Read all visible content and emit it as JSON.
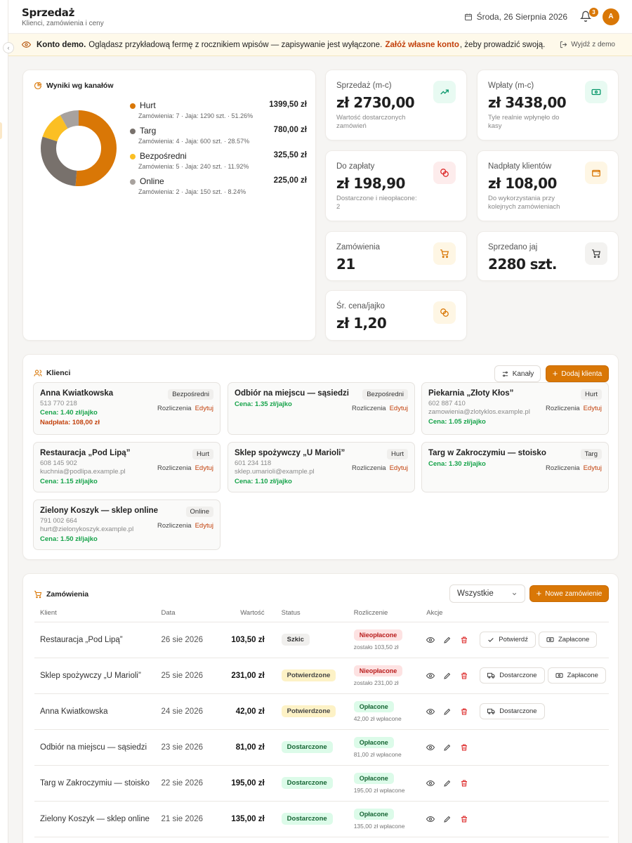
{
  "header": {
    "title": "Sprzedaż",
    "subtitle": "Klienci, zamówienia i ceny",
    "date": "Środa, 26 Sierpnia 2026",
    "notifications": "3",
    "avatar": "A"
  },
  "banner": {
    "bold": "Konto demo.",
    "text1": "Oglądasz przykładową fermę z rocznikiem wpisów — zapisywanie jest wyłączone.",
    "link": "Załóż własne konto",
    "text2": ", żeby prowadzić swoją.",
    "exit": "Wyjdź z demo"
  },
  "channels": {
    "title": "Wyniki wg kanałów",
    "items": [
      {
        "name": "Hurt",
        "value": "1399,50 zł",
        "meta": "Zamówienia: 7 · Jaja: 1290 szt. · 51.26%",
        "color": "#d97706"
      },
      {
        "name": "Targ",
        "value": "780,00 zł",
        "meta": "Zamówienia: 4 · Jaja: 600 szt. · 28.57%",
        "color": "#78716c"
      },
      {
        "name": "Bezpośredni",
        "value": "325,50 zł",
        "meta": "Zamówienia: 5 · Jaja: 240 szt. · 11.92%",
        "color": "#fbbf24"
      },
      {
        "name": "Online",
        "value": "225,00 zł",
        "meta": "Zamówienia: 2 · Jaja: 150 szt. · 8.24%",
        "color": "#a8a29e"
      }
    ]
  },
  "chart_data": {
    "type": "pie",
    "categories": [
      "Hurt",
      "Targ",
      "Bezpośredni",
      "Online"
    ],
    "values": [
      1399.5,
      780.0,
      325.5,
      225.0
    ],
    "percent": [
      51.26,
      28.57,
      11.92,
      8.24
    ],
    "title": "Wyniki wg kanałów"
  },
  "stats": [
    {
      "label": "Sprzedaż (m-c)",
      "value": "zł 2730,00",
      "desc": "Wartość dostarczonych zamówień",
      "icon": "trend-up-icon"
    },
    {
      "label": "Wpłaty (m-c)",
      "value": "zł 3438,00",
      "desc": "Tyle realnie wpłynęło do kasy",
      "icon": "cash-icon"
    },
    {
      "label": "Do zapłaty",
      "value": "zł 198,90",
      "desc": "Dostarczone i nieopłacone: 2",
      "icon": "coins-icon"
    },
    {
      "label": "Nadpłaty klientów",
      "value": "zł 108,00",
      "desc": "Do wykorzystania przy kolejnych zamówieniach",
      "icon": "wallet-icon"
    },
    {
      "label": "Zamówienia",
      "value": "21",
      "desc": "",
      "icon": "cart-icon"
    },
    {
      "label": "Sprzedano jaj",
      "value": "2280 szt.",
      "desc": "",
      "icon": "cart-icon"
    },
    {
      "label": "Śr. cena/jajko",
      "value": "zł 1,20",
      "desc": "",
      "icon": "coins-icon"
    }
  ],
  "customers": {
    "title": "Klienci",
    "channels_button": "Kanały",
    "add_button": "Dodaj klienta",
    "settlements": "Rozliczenia",
    "edit": "Edytuj",
    "items": [
      {
        "name": "Anna Kwiatkowska",
        "chip": "Bezpośredni",
        "phone": "513 770 218",
        "email": "",
        "price": "Cena: 1.40 zł/jajko",
        "overpay": "Nadpłata: 108,00 zł"
      },
      {
        "name": "Odbiór na miejscu — sąsiedzi",
        "chip": "Bezpośredni",
        "phone": "",
        "email": "",
        "price": "Cena: 1.35 zł/jajko",
        "overpay": ""
      },
      {
        "name": "Piekarnia „Złoty Kłos”",
        "chip": "Hurt",
        "phone": "602 887 410",
        "email": "zamowienia@zlotyklos.example.pl",
        "price": "Cena: 1.05 zł/jajko",
        "overpay": ""
      },
      {
        "name": "Restauracja „Pod Lipą”",
        "chip": "Hurt",
        "phone": "608 145 902",
        "email": "kuchnia@podlipa.example.pl",
        "price": "Cena: 1.15 zł/jajko",
        "overpay": ""
      },
      {
        "name": "Sklep spożywczy „U Marioli”",
        "chip": "Hurt",
        "phone": "601 234 118",
        "email": "sklep.umarioli@example.pl",
        "price": "Cena: 1.10 zł/jajko",
        "overpay": ""
      },
      {
        "name": "Targ w Zakroczymiu — stoisko",
        "chip": "Targ",
        "phone": "",
        "email": "",
        "price": "Cena: 1.30 zł/jajko",
        "overpay": ""
      },
      {
        "name": "Zielony Koszyk — sklep online",
        "chip": "Online",
        "phone": "791 002 664",
        "email": "hurt@zielonykoszyk.example.pl",
        "price": "Cena: 1.50 zł/jajko",
        "overpay": ""
      }
    ]
  },
  "orders": {
    "title": "Zamówienia",
    "filter": "Wszystkie",
    "new_button": "Nowe zamówienie",
    "columns": [
      "Klient",
      "Data",
      "Wartość",
      "Status",
      "Rozliczenie",
      "Akcje"
    ],
    "rows": [
      {
        "client": "Restauracja „Pod Lipą”",
        "date": "26 sie 2026",
        "value": "103,50 zł",
        "status": "Szkic",
        "status_kind": "gray",
        "pay": "Nieopłacone",
        "pay_kind": "red",
        "pay_sub": "zostało 103,50 zł",
        "buttons": [
          "Potwierdź",
          "Zapłacone"
        ]
      },
      {
        "client": "Sklep spożywczy „U Marioli”",
        "date": "25 sie 2026",
        "value": "231,00 zł",
        "status": "Potwierdzone",
        "status_kind": "yellow",
        "pay": "Nieopłacone",
        "pay_kind": "red",
        "pay_sub": "zostało 231,00 zł",
        "buttons": [
          "Dostarczone",
          "Zapłacone"
        ]
      },
      {
        "client": "Anna Kwiatkowska",
        "date": "24 sie 2026",
        "value": "42,00 zł",
        "status": "Potwierdzone",
        "status_kind": "yellow",
        "pay": "Opłacone",
        "pay_kind": "green",
        "pay_sub": "42,00 zł wpłacone",
        "buttons": [
          "Dostarczone"
        ]
      },
      {
        "client": "Odbiór na miejscu — sąsiedzi",
        "date": "23 sie 2026",
        "value": "81,00 zł",
        "status": "Dostarczone",
        "status_kind": "green",
        "pay": "Opłacone",
        "pay_kind": "green",
        "pay_sub": "81,00 zł wpłacone",
        "buttons": []
      },
      {
        "client": "Targ w Zakroczymiu — stoisko",
        "date": "22 sie 2026",
        "value": "195,00 zł",
        "status": "Dostarczone",
        "status_kind": "green",
        "pay": "Opłacone",
        "pay_kind": "green",
        "pay_sub": "195,00 zł wpłacone",
        "buttons": []
      },
      {
        "client": "Zielony Koszyk — sklep online",
        "date": "21 sie 2026",
        "value": "135,00 zł",
        "status": "Dostarczone",
        "status_kind": "green",
        "pay": "Opłacone",
        "pay_kind": "green",
        "pay_sub": "135,00 zł wpłacone",
        "buttons": []
      }
    ]
  }
}
